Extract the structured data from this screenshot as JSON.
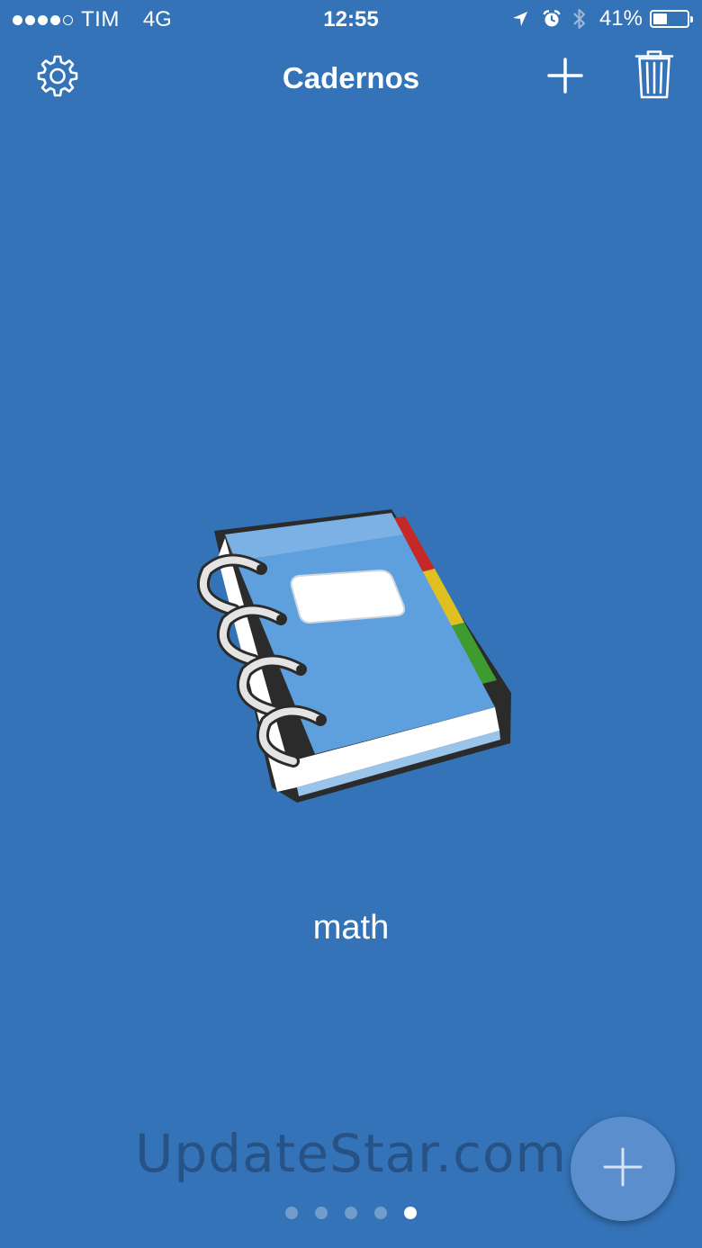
{
  "status_bar": {
    "signal_bars_filled": 4,
    "signal_bars_total": 5,
    "carrier": "TIM",
    "network": "4G",
    "time": "12:55",
    "icons": [
      "location-icon",
      "alarm-icon",
      "bluetooth-icon"
    ],
    "battery_percent_text": "41%",
    "battery_level": 0.41
  },
  "nav_bar": {
    "title": "Cadernos",
    "left_icon": "gear-icon",
    "right_icons": [
      "plus-icon",
      "trash-icon"
    ]
  },
  "notebook": {
    "name": "math",
    "icon": "notebook-icon",
    "tab_colors": [
      "#c62828",
      "#e0c020",
      "#3f9a2f"
    ],
    "cover_color": "#5ea0de"
  },
  "watermark": "UpdateStar.com",
  "fab": {
    "icon": "plus-icon",
    "color": "#5a8ecc"
  },
  "pagination": {
    "total": 5,
    "current": 5
  },
  "colors": {
    "background": "#3473b7",
    "text": "#ffffff"
  }
}
